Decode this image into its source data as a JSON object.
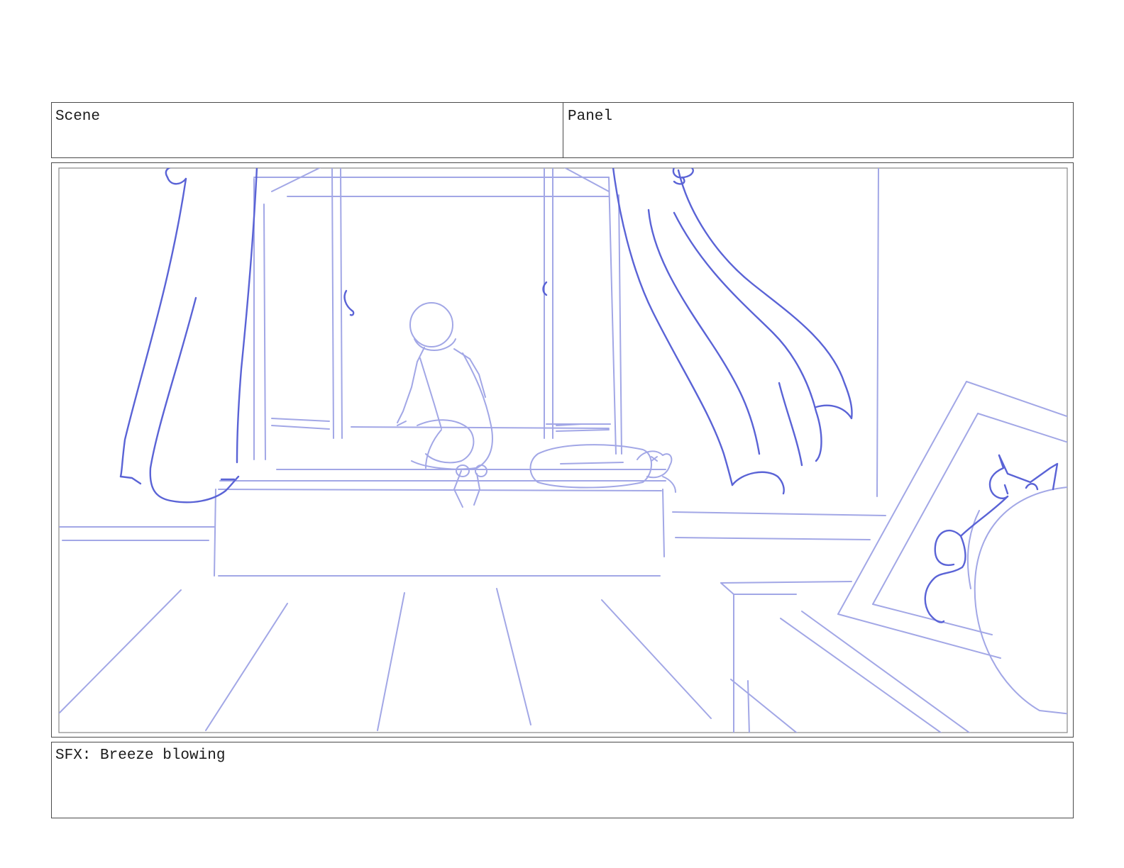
{
  "header": {
    "scene_label": "Scene",
    "panel_label": "Panel"
  },
  "notes": {
    "text": "SFX: Breeze blowing"
  },
  "colors": {
    "pencil_dark": "#5a63d6",
    "pencil_light": "#a2a7e6",
    "border": "#4a4a4a"
  }
}
